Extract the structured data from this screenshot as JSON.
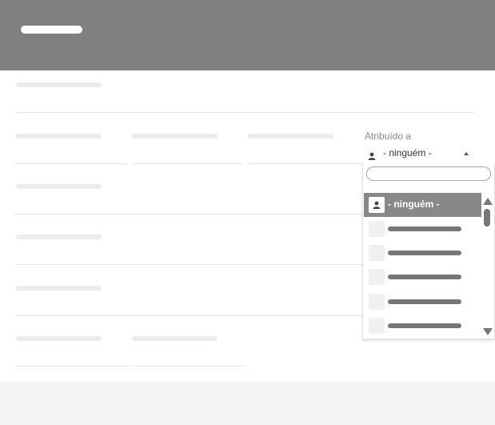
{
  "assignee": {
    "label": "Atribuído a",
    "selected_value": "- ninguém -",
    "search_value": "",
    "options": [
      {
        "label": "- ninguém -",
        "selected": true
      },
      {
        "label": "",
        "selected": false
      },
      {
        "label": "",
        "selected": false
      },
      {
        "label": "",
        "selected": false
      },
      {
        "label": "",
        "selected": false
      },
      {
        "label": "",
        "selected": false
      }
    ]
  },
  "icons": {
    "user": "user-icon",
    "caret": "caret-up-icon",
    "scroll_up": "scroll-up-arrow-icon",
    "scroll_down": "scroll-down-arrow-icon"
  },
  "colors": {
    "header": "#808080",
    "selected_option": "#888888",
    "footer": "#f3f3f3"
  }
}
